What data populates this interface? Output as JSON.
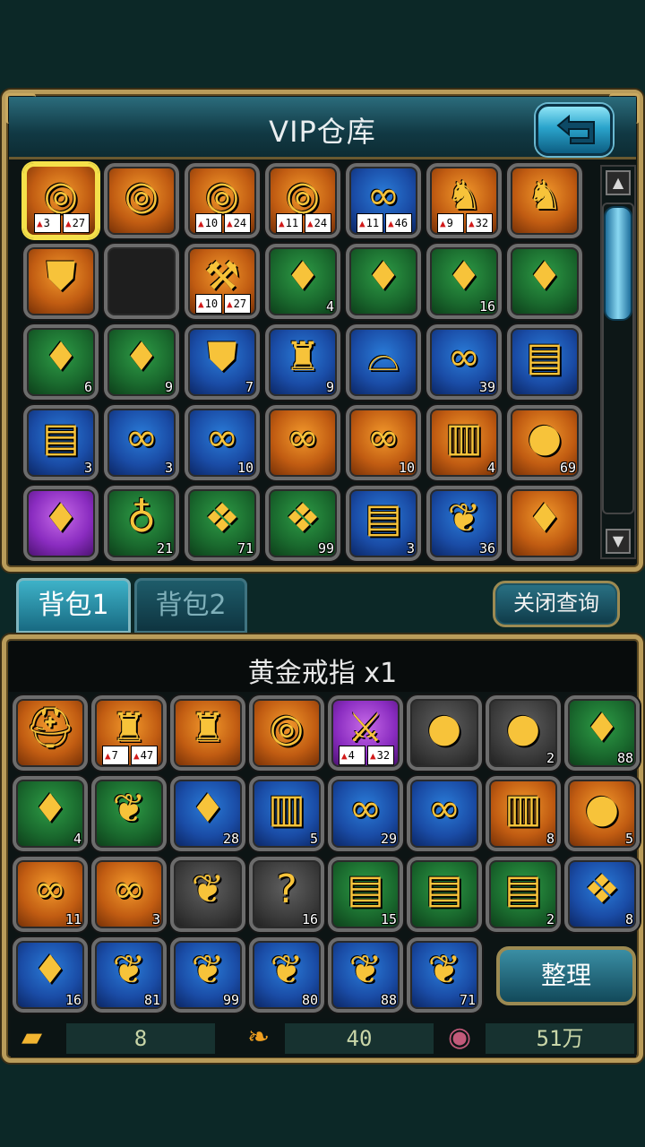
{
  "vip_title": "VIP仓库",
  "tabs": [
    "背包1",
    "背包2"
  ],
  "close_query": "关闭查询",
  "selected_item": "黄金戒指 x1",
  "sort_label": "整理",
  "resources": {
    "gold": "8",
    "leaf": "40",
    "coin": "51万"
  },
  "icons": {
    "ring": "◎",
    "horse": "♞",
    "gem": "♦",
    "chain": "∞",
    "scroll": "▤",
    "bag": "●",
    "book": "▥",
    "gift": "❖",
    "sprig": "❦",
    "potion": "♁",
    "armor": "⛊",
    "robe": "♜",
    "skirt": "⌓",
    "sword": "⚔",
    "helm": "⛑",
    "question": "?",
    "wand": "⚒",
    "empty": ""
  },
  "vip_items": [
    {
      "icon": "ring",
      "bg": "orange",
      "stats": [
        "3",
        "27"
      ],
      "sel": true
    },
    {
      "icon": "ring",
      "bg": "orange"
    },
    {
      "icon": "ring",
      "bg": "orange",
      "stats": [
        "10",
        "24"
      ]
    },
    {
      "icon": "ring",
      "bg": "orange",
      "stats": [
        "11",
        "24"
      ]
    },
    {
      "icon": "chain",
      "bg": "blue",
      "stats": [
        "11",
        "46"
      ]
    },
    {
      "icon": "horse",
      "bg": "orange",
      "stats": [
        "9",
        "32"
      ]
    },
    {
      "icon": "horse",
      "bg": "orange"
    },
    {
      "icon": "armor",
      "bg": "orange"
    },
    {
      "icon": "empty",
      "bg": "empty"
    },
    {
      "icon": "wand",
      "bg": "orange",
      "stats": [
        "10",
        "27"
      ]
    },
    {
      "icon": "gem",
      "bg": "green",
      "count": "4"
    },
    {
      "icon": "gem",
      "bg": "green"
    },
    {
      "icon": "gem",
      "bg": "green",
      "count": "16"
    },
    {
      "icon": "gem",
      "bg": "green"
    },
    {
      "icon": "gem",
      "bg": "green",
      "count": "6"
    },
    {
      "icon": "gem",
      "bg": "green",
      "count": "9"
    },
    {
      "icon": "armor",
      "bg": "blue",
      "count": "7"
    },
    {
      "icon": "robe",
      "bg": "blue",
      "count": "9"
    },
    {
      "icon": "skirt",
      "bg": "blue"
    },
    {
      "icon": "chain",
      "bg": "blue",
      "count": "39"
    },
    {
      "icon": "scroll",
      "bg": "blue"
    },
    {
      "icon": "scroll",
      "bg": "blue",
      "count": "3"
    },
    {
      "icon": "chain",
      "bg": "blue",
      "count": "3"
    },
    {
      "icon": "chain",
      "bg": "blue",
      "count": "10"
    },
    {
      "icon": "chain",
      "bg": "orange"
    },
    {
      "icon": "chain",
      "bg": "orange",
      "count": "10"
    },
    {
      "icon": "book",
      "bg": "orange",
      "count": "4"
    },
    {
      "icon": "bag",
      "bg": "orange",
      "count": "69"
    },
    {
      "icon": "gem",
      "bg": "purple"
    },
    {
      "icon": "potion",
      "bg": "green",
      "count": "21"
    },
    {
      "icon": "gift",
      "bg": "green",
      "count": "71"
    },
    {
      "icon": "gift",
      "bg": "green",
      "count": "99"
    },
    {
      "icon": "scroll",
      "bg": "blue",
      "count": "3"
    },
    {
      "icon": "sprig",
      "bg": "blue",
      "count": "36"
    },
    {
      "icon": "gem",
      "bg": "orange"
    }
  ],
  "bag_items": [
    {
      "icon": "helm",
      "bg": "orange"
    },
    {
      "icon": "robe",
      "bg": "orange",
      "stats": [
        "7",
        "47"
      ]
    },
    {
      "icon": "robe",
      "bg": "orange"
    },
    {
      "icon": "ring",
      "bg": "orange"
    },
    {
      "icon": "sword",
      "bg": "purple",
      "stats": [
        "4",
        "32"
      ]
    },
    {
      "icon": "bag",
      "bg": "gray"
    },
    {
      "icon": "bag",
      "bg": "gray",
      "count": "2"
    },
    {
      "icon": "gem",
      "bg": "green",
      "count": "88"
    },
    {
      "icon": "gem",
      "bg": "green",
      "count": "4"
    },
    {
      "icon": "sprig",
      "bg": "green"
    },
    {
      "icon": "gem",
      "bg": "blue",
      "count": "28"
    },
    {
      "icon": "book",
      "bg": "blue",
      "count": "5"
    },
    {
      "icon": "chain",
      "bg": "blue",
      "count": "29"
    },
    {
      "icon": "chain",
      "bg": "blue"
    },
    {
      "icon": "book",
      "bg": "orange",
      "count": "8"
    },
    {
      "icon": "bag",
      "bg": "orange",
      "count": "5"
    },
    {
      "icon": "chain",
      "bg": "orange",
      "count": "11"
    },
    {
      "icon": "chain",
      "bg": "orange",
      "count": "3"
    },
    {
      "icon": "sprig",
      "bg": "gray"
    },
    {
      "icon": "question",
      "bg": "gray",
      "count": "16"
    },
    {
      "icon": "scroll",
      "bg": "green",
      "count": "15"
    },
    {
      "icon": "scroll",
      "bg": "green"
    },
    {
      "icon": "scroll",
      "bg": "green",
      "count": "2"
    },
    {
      "icon": "gift",
      "bg": "blue",
      "count": "8"
    },
    {
      "icon": "gem",
      "bg": "blue",
      "count": "16"
    },
    {
      "icon": "sprig",
      "bg": "blue",
      "count": "81"
    },
    {
      "icon": "sprig",
      "bg": "blue",
      "count": "99"
    },
    {
      "icon": "sprig",
      "bg": "blue",
      "count": "80"
    },
    {
      "icon": "sprig",
      "bg": "blue",
      "count": "88"
    },
    {
      "icon": "sprig",
      "bg": "blue",
      "count": "71"
    }
  ]
}
